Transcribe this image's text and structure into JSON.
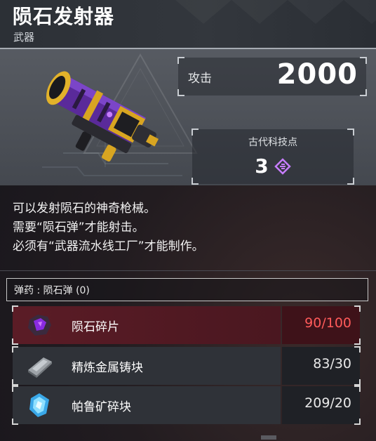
{
  "item": {
    "name": "陨石发射器",
    "category": "武器"
  },
  "stats": {
    "attack_label": "攻击",
    "attack_value": "2000"
  },
  "tech": {
    "label": "古代科技点",
    "value": "3",
    "icon": "ancient-tech-point-icon",
    "icon_color": "#c77dff"
  },
  "description": [
    "可以发射陨石的神奇枪械。",
    "需要“陨石弹”才能射击。",
    "必须有“武器流水线工厂”才能制作。"
  ],
  "ammo": {
    "text": "弹药 : 陨石弹 (0)"
  },
  "materials": [
    {
      "name": "陨石碎片",
      "count": "90/100",
      "icon": "meteorite-fragment-icon",
      "insufficient": true
    },
    {
      "name": "精炼金属铸块",
      "count": "83/30",
      "icon": "refined-ingot-icon",
      "insufficient": false
    },
    {
      "name": "帕鲁矿碎块",
      "count": "209/20",
      "icon": "paldium-fragment-icon",
      "insufficient": false
    }
  ],
  "colors": {
    "insufficient": "#ff5a5a",
    "weapon_purple": "#6a2fb0",
    "weapon_gold": "#d8a521"
  }
}
